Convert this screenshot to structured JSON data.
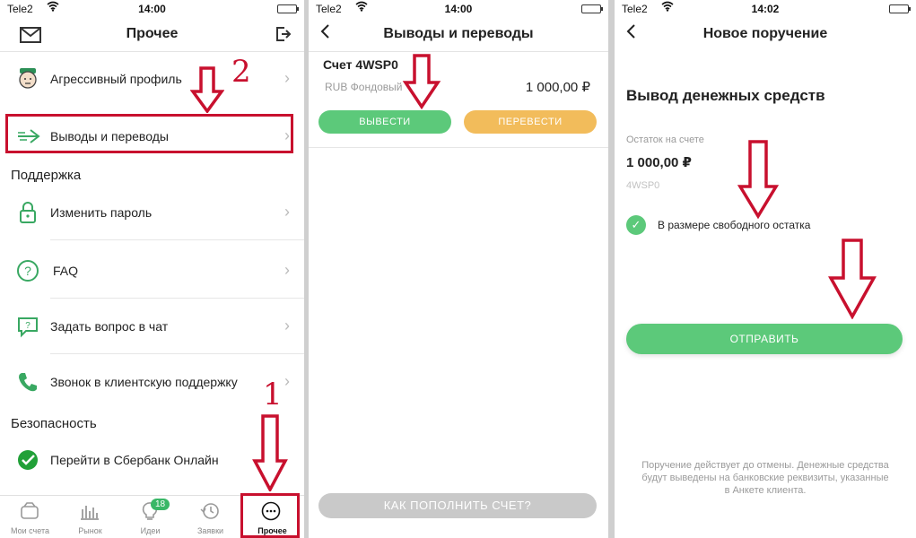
{
  "status": [
    {
      "carrier": "Tele2",
      "time": "14:00"
    },
    {
      "carrier": "Tele2",
      "time": "14:00"
    },
    {
      "carrier": "Tele2",
      "time": "14:02"
    }
  ],
  "screen1": {
    "title": "Прочее",
    "rows": [
      {
        "label": "Агрессивный профиль",
        "icon": "profile-avatar-icon"
      },
      {
        "label": "Выводы и переводы",
        "icon": "transfer-arrow-icon"
      },
      {
        "label": "Изменить пароль",
        "icon": "lock-icon"
      },
      {
        "label": "FAQ",
        "icon": "question-icon"
      },
      {
        "label": "Задать вопрос в чат",
        "icon": "chat-icon"
      },
      {
        "label": "Звонок в клиентскую поддержку",
        "icon": "phone-icon"
      },
      {
        "label": "Перейти в Сбербанк Онлайн",
        "icon": "sberbank-logo-icon"
      }
    ],
    "sections": {
      "support": "Поддержка",
      "security": "Безопасность"
    },
    "annotations": {
      "n1": "1",
      "n2": "2"
    },
    "tabs": [
      {
        "label": "Мои счета",
        "icon": "wallet-icon"
      },
      {
        "label": "Рынок",
        "icon": "market-chart-icon"
      },
      {
        "label": "Идеи",
        "icon": "lightbulb-icon",
        "badge": "18"
      },
      {
        "label": "Заявки",
        "icon": "history-clock-icon"
      },
      {
        "label": "Прочее",
        "icon": "more-dots-icon"
      }
    ]
  },
  "screen2": {
    "title": "Выводы и переводы",
    "account_title": "Счет 4WSP0",
    "account_sub": "RUB Фондовый",
    "amount": "1 000,00 ₽",
    "withdraw": "ВЫВЕСТИ",
    "transfer": "ПЕРЕВЕСТИ",
    "topup": "КАК ПОПОЛНИТЬ СЧЕТ?"
  },
  "screen3": {
    "title": "Новое поручение",
    "heading": "Вывод денежных средств",
    "balance_label": "Остаток на счете",
    "balance": "1 000,00 ₽",
    "account": "4WSP0",
    "checkbox_label": "В размере свободного остатка",
    "submit": "ОТПРАВИТЬ",
    "footnote": "Поручение действует до отмены. Денежные средства будут выведены на банковские реквизиты, указанные в Анкете клиента."
  },
  "colors": {
    "accent_green": "#5cc97a",
    "orange": "#f2bc5b",
    "annotation_red": "#c8102e"
  }
}
